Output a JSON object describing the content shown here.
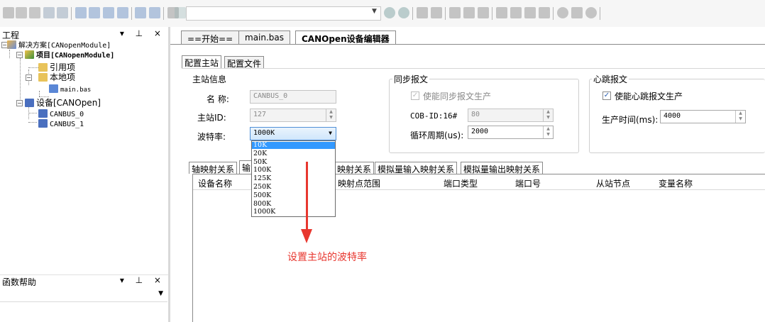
{
  "toolbar": {
    "icons": [
      "cut-icon",
      "copy-icon",
      "paste-icon",
      "undo-icon",
      "redo-icon",
      "window-icon",
      "comment-icon",
      "chat-icon",
      "chat-down-icon",
      "chat-arrow-icon",
      "chat-box-icon",
      "list-icon",
      "book-icon",
      "wand-icon",
      "circle-target-icon",
      "circle-target-2-icon",
      "indent-icon",
      "outdent-icon",
      "align-left-icon",
      "align-right-icon",
      "list-indent-icon",
      "play-icon",
      "step-icon",
      "stop-icon",
      "pause-icon",
      "record-icon",
      "monitor-icon",
      "search-icon"
    ]
  },
  "project_panel": {
    "title": "工程",
    "controls": "▾ ⊥ ×",
    "tree": {
      "solution": "解决方案[CANopenModule]",
      "project": "项目[CANopenModule]",
      "references": "引用项",
      "local": "本地项",
      "main_file": "main.bas",
      "devices": "设备[CANOpen]",
      "device_0": "CANBUS_0",
      "device_1": "CANBUS_1"
    }
  },
  "help_panel": {
    "title": "函数帮助",
    "controls": "▾ ⊥ ×"
  },
  "doc_tabs": [
    "==开始==",
    "main.bas",
    "CANOpen设备编辑器"
  ],
  "editor": {
    "top_tabs": [
      "配置主站",
      "配置文件"
    ],
    "master_info": {
      "title": "主站信息",
      "name_label": "名  称:",
      "name_value": "CANBUS_0",
      "id_label": "主站ID:",
      "id_value": "127",
      "baud_label": "波特率:",
      "baud_value": "1000K"
    },
    "sync_msg": {
      "title": "同步报文",
      "enable_label": "使能同步报文生产",
      "cobid_label": "COB-ID:16#",
      "cobid_value": "80",
      "cycle_label": "循环周期(us):",
      "cycle_value": "2000"
    },
    "heartbeat": {
      "title": "心跳报文",
      "enable_label": "使能心跳报文生产",
      "time_label": "生产时间(ms):",
      "time_value": "4000"
    },
    "map_tabs": [
      "轴映射关系",
      "输",
      "映射关系",
      "模拟量输入映射关系",
      "模拟量输出映射关系"
    ],
    "grid_headers": [
      "设备名称",
      "映射点范围",
      "端口类型",
      "端口号",
      "从站节点",
      "变量名称"
    ]
  },
  "baud_dropdown": {
    "options": [
      "10K",
      "20K",
      "50K",
      "100K",
      "125K",
      "250K",
      "500K",
      "800K",
      "1000K"
    ],
    "highlighted": "10K"
  },
  "annotation": "设置主站的波特率",
  "colors": {
    "accent": "#3399ff",
    "annotation": "#e8372f"
  }
}
